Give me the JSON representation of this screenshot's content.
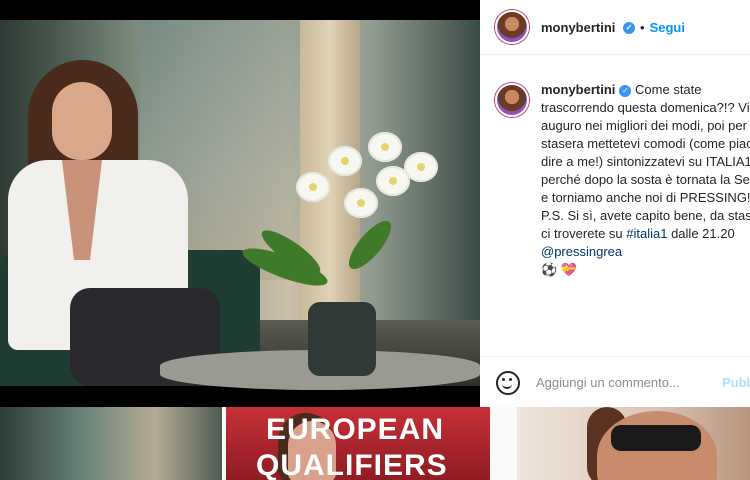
{
  "post": {
    "image_alt": "Donna seduta accanto a un'orchidea bianca"
  },
  "header": {
    "username": "monybertini",
    "separator": "•",
    "follow_label": "Segui"
  },
  "caption": {
    "username": "monybertini",
    "text_before_tag": "Come state trascorrendo questa domenica?!? Vi auguro nei migliori dei modi, poi per stasera mettetevi comodi (come piace dire a me!) sintonizzatevi su ITALIA1 perché dopo la sosta è tornata la Serie A e torniamo anche noi di PRESSING!!! P.S. Si sì, avete capito bene, da stasera ci troverete su ",
    "hashtag": "#italia1",
    "text_mid": " dalle 21.20 ",
    "mention": "@pressingrea",
    "emojis": "⚽ 💝"
  },
  "comment": {
    "placeholder": "Aggiungi un commento...",
    "publish_label": "Pubb"
  },
  "grid": {
    "thumb2_line1": "EUROPEAN",
    "thumb2_line2": "QUALIFIERS"
  },
  "colors": {
    "accent": "#0095f6",
    "verified": "#3897f0"
  }
}
